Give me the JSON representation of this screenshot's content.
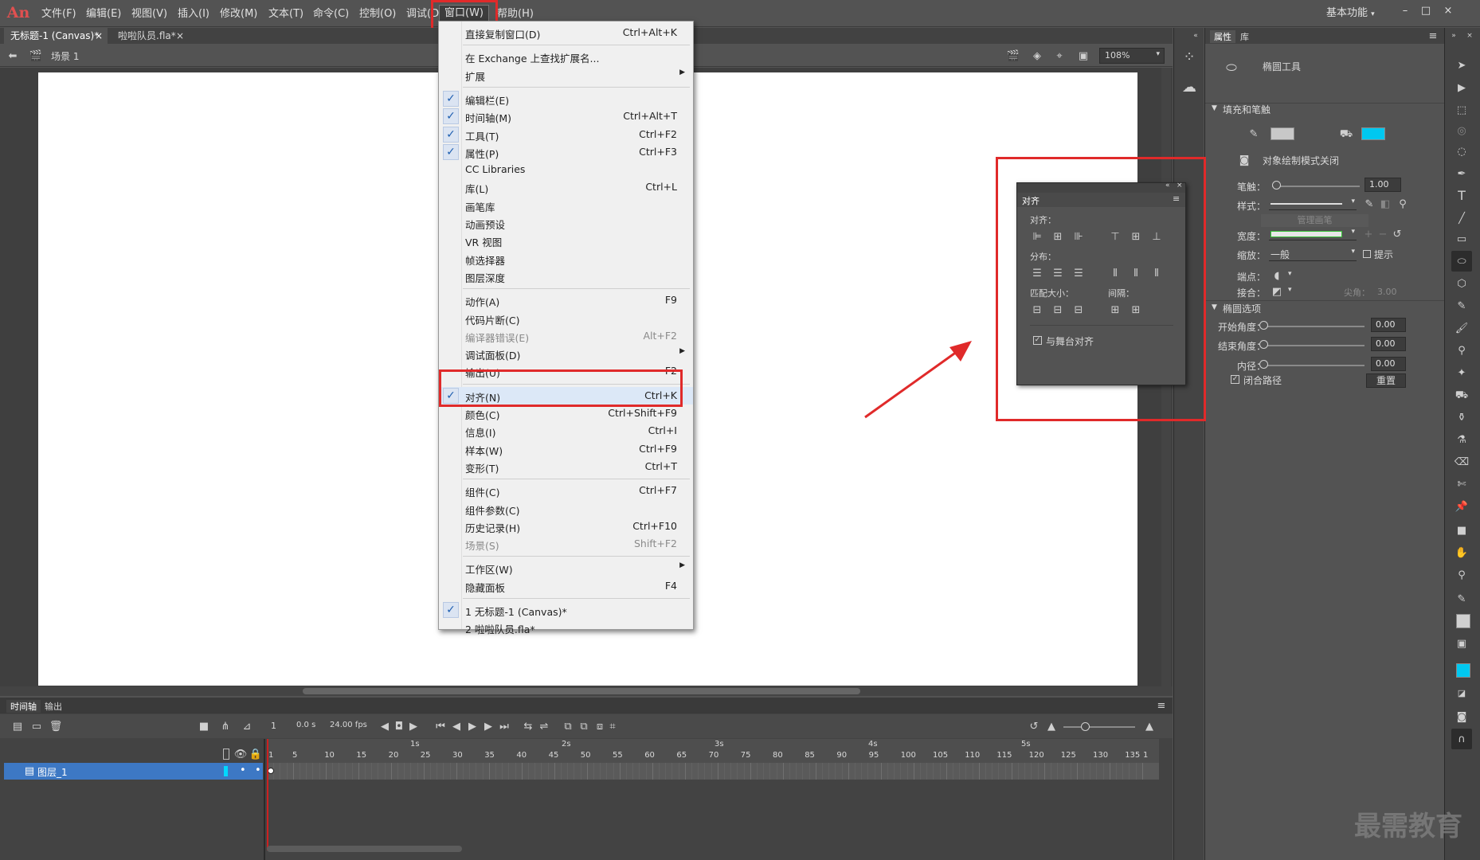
{
  "app": {
    "logo": "An",
    "workspace": "基本功能"
  },
  "menubar": [
    "文件(F)",
    "编辑(E)",
    "视图(V)",
    "插入(I)",
    "修改(M)",
    "文本(T)",
    "命令(C)",
    "控制(O)",
    "调试(D)",
    "窗口(W)",
    "帮助(H)"
  ],
  "window_controls": [
    "–",
    "□",
    "×"
  ],
  "doc_tabs": [
    {
      "label": "无标题-1 (Canvas)*",
      "close": "×"
    },
    {
      "label": "啦啦队员.fla*",
      "close": "×"
    }
  ],
  "scene": {
    "label": "场景 1",
    "zoom": "108%"
  },
  "window_menu": {
    "items": [
      {
        "label": "直接复制窗口(D)",
        "shortcut": "Ctrl+Alt+K"
      },
      {
        "sep": true
      },
      {
        "label": "在 Exchange 上查找扩展名...",
        "shortcut": ""
      },
      {
        "label": "扩展",
        "submenu": "▶"
      },
      {
        "sep": true
      },
      {
        "label": "编辑栏(E)",
        "checked": "✓"
      },
      {
        "label": "时间轴(M)",
        "shortcut": "Ctrl+Alt+T",
        "checked": "✓"
      },
      {
        "label": "工具(T)",
        "shortcut": "Ctrl+F2",
        "checked": "✓"
      },
      {
        "label": "属性(P)",
        "shortcut": "Ctrl+F3",
        "checked": "✓"
      },
      {
        "label": "CC Libraries"
      },
      {
        "label": "库(L)",
        "shortcut": "Ctrl+L"
      },
      {
        "label": "画笔库"
      },
      {
        "label": "动画预设"
      },
      {
        "label": "VR 视图"
      },
      {
        "label": "帧选择器"
      },
      {
        "label": "图层深度"
      },
      {
        "sep": true
      },
      {
        "label": "动作(A)",
        "shortcut": "F9"
      },
      {
        "label": "代码片断(C)"
      },
      {
        "label": "编译器错误(E)",
        "shortcut": "Alt+F2",
        "disabled": true
      },
      {
        "label": "调试面板(D)",
        "submenu": "▶"
      },
      {
        "label": "输出(U)",
        "shortcut": "F2"
      },
      {
        "sep": true
      },
      {
        "label": "对齐(N)",
        "shortcut": "Ctrl+K",
        "checked": "✓",
        "highlight": true
      },
      {
        "label": "颜色(C)",
        "shortcut": "Ctrl+Shift+F9"
      },
      {
        "label": "信息(I)",
        "shortcut": "Ctrl+I"
      },
      {
        "label": "样本(W)",
        "shortcut": "Ctrl+F9"
      },
      {
        "label": "变形(T)",
        "shortcut": "Ctrl+T"
      },
      {
        "sep": true
      },
      {
        "label": "组件(C)",
        "shortcut": "Ctrl+F7"
      },
      {
        "label": "组件参数(C)"
      },
      {
        "label": "历史记录(H)",
        "shortcut": "Ctrl+F10"
      },
      {
        "label": "场景(S)",
        "shortcut": "Shift+F2",
        "disabled": true
      },
      {
        "sep": true
      },
      {
        "label": "工作区(W)",
        "submenu": "▶"
      },
      {
        "label": "隐藏面板",
        "shortcut": "F4"
      },
      {
        "sep": true
      },
      {
        "label": "1 无标题-1 (Canvas)*",
        "checked": "✓"
      },
      {
        "label": "2 啦啦队员.fla*"
      }
    ]
  },
  "align_panel": {
    "title": "对齐",
    "sections": [
      "对齐：",
      "分布：",
      "匹配大小：",
      "间隔："
    ],
    "match_stage": "与舞台对齐",
    "check": "✓"
  },
  "properties": {
    "tabs": [
      "属性",
      "库"
    ],
    "tool": "椭圆工具",
    "fill_stroke": "填充和笔触",
    "fill_color": "#00c8f0",
    "stroke_color": "#c8c8c8",
    "object_draw": "对象绘制模式关闭",
    "stroke_label": "笔触：",
    "stroke_value": "1.00",
    "style_label": "样式：",
    "manage_brush": "管理画笔",
    "width_label": "宽度：",
    "scale_label": "缩放：",
    "scale_value": "一般",
    "hint_label": "提示",
    "cap_label": "端点：",
    "join_label": "接合：",
    "miter_label": "尖角：",
    "miter_value": "3.00",
    "ellipse_options": "椭圆选项",
    "start_angle_label": "开始角度：",
    "start_angle": "0.00",
    "end_angle_label": "结束角度：",
    "end_angle": "0.00",
    "inner_radius_label": "内径：",
    "inner_radius": "0.00",
    "close_path": "闭合路径",
    "reset": "重置"
  },
  "timeline": {
    "tabs": [
      "时间轴",
      "输出"
    ],
    "frame": "1",
    "time": "0.0 s",
    "fps": "24.00 fps",
    "layer": "图层_1",
    "seconds": [
      "1s",
      "2s",
      "3s",
      "4s",
      "5s"
    ],
    "frame_numbers": [
      "1",
      "5",
      "10",
      "15",
      "20",
      "25",
      "30",
      "35",
      "40",
      "45",
      "50",
      "55",
      "60",
      "65",
      "70",
      "75",
      "80",
      "85",
      "90",
      "95",
      "100",
      "105",
      "110",
      "115",
      "120",
      "125",
      "130",
      "135",
      "1"
    ]
  },
  "watermark": "最需教育"
}
